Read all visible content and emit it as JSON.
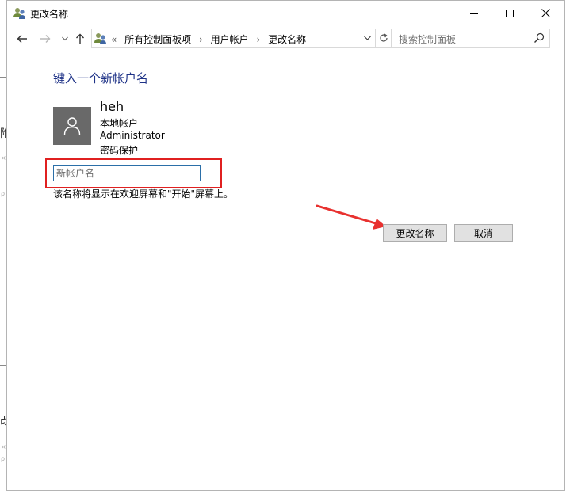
{
  "window": {
    "title": "更改名称"
  },
  "navbar": {
    "address": {
      "prefix": "«",
      "crumbs": [
        "所有控制面板项",
        "用户帐户",
        "更改名称"
      ],
      "separator": "›"
    },
    "search": {
      "placeholder": "搜索控制面板"
    }
  },
  "main": {
    "heading": "键入一个新帐户名",
    "user": {
      "name": "heh",
      "account_type": "本地帐户",
      "role": "Administrator",
      "protection": "密码保护"
    },
    "name_input": {
      "placeholder": "新帐户名",
      "value": ""
    },
    "description": "该名称将显示在欢迎屏幕和\"开始\"屏幕上。",
    "buttons": {
      "rename": "更改名称",
      "cancel": "取消"
    }
  },
  "colors": {
    "heading": "#1e3287",
    "highlight_box": "#e02020",
    "annotation_arrow": "#e8312f",
    "avatar_bg": "#696969"
  },
  "icons": [
    "users-icon",
    "minimize-icon",
    "maximize-icon",
    "close-icon",
    "back-arrow-icon",
    "forward-arrow-icon",
    "up-arrow-icon",
    "chevron-down-icon",
    "refresh-icon",
    "search-icon",
    "user-avatar-icon"
  ]
}
